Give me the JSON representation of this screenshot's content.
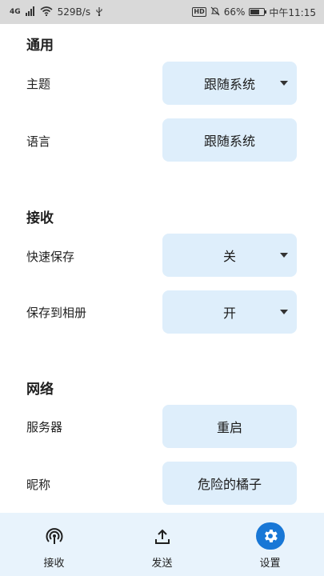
{
  "status_bar": {
    "signal": "4G",
    "speed": "529B/s",
    "hd": "HD",
    "battery": "66%",
    "battery_level": 0.66,
    "time": "中午11:15"
  },
  "sections": {
    "general": {
      "title": "通用",
      "theme": {
        "label": "主题",
        "value": "跟随系统"
      },
      "language": {
        "label": "语言",
        "value": "跟随系统"
      }
    },
    "receive": {
      "title": "接收",
      "quick_save": {
        "label": "快速保存",
        "value": "关"
      },
      "save_to_album": {
        "label": "保存到相册",
        "value": "开"
      }
    },
    "network": {
      "title": "网络",
      "server": {
        "label": "服务器",
        "value": "重启"
      },
      "nickname": {
        "label": "昵称",
        "value": "危险的橘子"
      }
    }
  },
  "nav": {
    "receive": "接收",
    "send": "发送",
    "settings": "设置",
    "active": "settings",
    "accent": "#1877d6"
  },
  "colors": {
    "button_bg": "#deeefb",
    "nav_bg": "#e8f3fc"
  }
}
